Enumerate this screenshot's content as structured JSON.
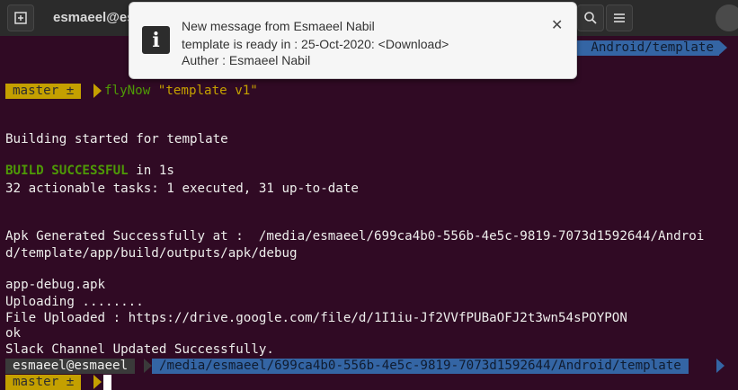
{
  "window": {
    "title": "esmaeel@es",
    "new_tab_icon": "new-tab-icon",
    "search_icon": "search-icon",
    "menu_icon": "hamburger-menu-icon"
  },
  "prompt_top": {
    "path": "Android/template"
  },
  "prompt1": {
    "branch": "master ±",
    "command": "flyNow",
    "argument": "\"template v1\""
  },
  "output": {
    "line_building": "Building started for template",
    "build_successful": "BUILD SUCCESSFUL",
    "build_time": " in 1s",
    "tasks": "32 actionable tasks: 1 executed, 31 up-to-date",
    "apk_line1": "Apk Generated Successfully at :  /media/esmaeel/699ca4b0-556b-4e5c-9819-7073d1592644/Androi",
    "apk_line2": "d/template/app/build/outputs/apk/debug",
    "apk_name": "app-debug.apk",
    "uploading": "Uploading ........",
    "file_uploaded": "File Uploaded : https://drive.google.com/file/d/1I1iu-Jf2VVfPUBaOFJ2t3wn54sPOYPON",
    "ok": "ok",
    "slack": "Slack Channel Updated Successfully."
  },
  "prompt2": {
    "user": "esmaeel@esmaeel",
    "path": "/media/esmaeel/699ca4b0-556b-4e5c-9819-7073d1592644/Android/template"
  },
  "prompt3": {
    "branch": "master ±"
  },
  "notification": {
    "icon": "info-icon",
    "title": "New message from Esmaeel Nabil",
    "line1": "template is ready in : 25-Oct-2020: <Download>",
    "line2": "Auther : Esmaeel Nabil",
    "close": "✕"
  },
  "colors": {
    "terminal_bg": "#300a24",
    "prompt_yellow": "#c4a000",
    "prompt_blue": "#3465a4",
    "success_green": "#4e9a06"
  }
}
